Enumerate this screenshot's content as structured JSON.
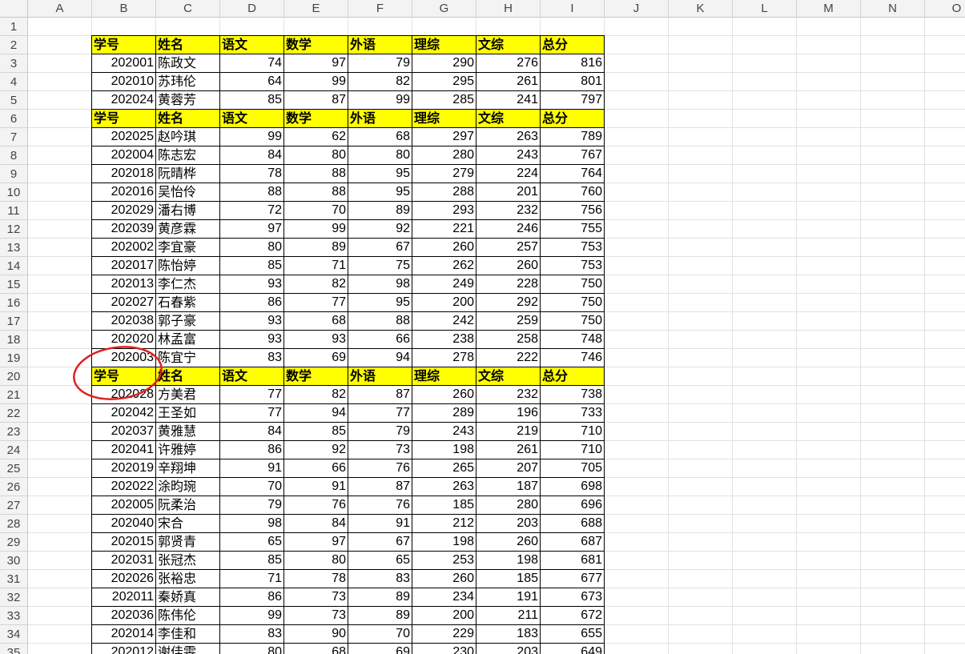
{
  "columns": [
    "A",
    "B",
    "C",
    "D",
    "E",
    "F",
    "G",
    "H",
    "I",
    "J",
    "K",
    "L",
    "M",
    "N",
    "O"
  ],
  "row_numbers": [
    "1",
    "2",
    "3",
    "4",
    "5",
    "6",
    "7",
    "8",
    "9",
    "10",
    "11",
    "12",
    "13",
    "14",
    "15",
    "16",
    "17",
    "18",
    "19",
    "20",
    "21",
    "22",
    "23",
    "24",
    "25",
    "26",
    "27",
    "28",
    "29",
    "30",
    "31",
    "32",
    "33",
    "34",
    "35"
  ],
  "header_labels": [
    "学号",
    "姓名",
    "语文",
    "数学",
    "外语",
    "理综",
    "文综",
    "总分"
  ],
  "header_fill": "#ffff00",
  "annotation_color": "#e02020",
  "rows": [
    null,
    "header",
    [
      "202001",
      "陈政文",
      "74",
      "97",
      "79",
      "290",
      "276",
      "816"
    ],
    [
      "202010",
      "苏玮伦",
      "64",
      "99",
      "82",
      "295",
      "261",
      "801"
    ],
    [
      "202024",
      "黄蓉芳",
      "85",
      "87",
      "99",
      "285",
      "241",
      "797"
    ],
    "header",
    [
      "202025",
      "赵吟琪",
      "99",
      "62",
      "68",
      "297",
      "263",
      "789"
    ],
    [
      "202004",
      "陈志宏",
      "84",
      "80",
      "80",
      "280",
      "243",
      "767"
    ],
    [
      "202018",
      "阮晴桦",
      "78",
      "88",
      "95",
      "279",
      "224",
      "764"
    ],
    [
      "202016",
      "吴怡伶",
      "88",
      "88",
      "95",
      "288",
      "201",
      "760"
    ],
    [
      "202029",
      "潘右博",
      "72",
      "70",
      "89",
      "293",
      "232",
      "756"
    ],
    [
      "202039",
      "黄彦霖",
      "97",
      "99",
      "92",
      "221",
      "246",
      "755"
    ],
    [
      "202002",
      "李宜豪",
      "80",
      "89",
      "67",
      "260",
      "257",
      "753"
    ],
    [
      "202017",
      "陈怡婷",
      "85",
      "71",
      "75",
      "262",
      "260",
      "753"
    ],
    [
      "202013",
      "李仁杰",
      "93",
      "82",
      "98",
      "249",
      "228",
      "750"
    ],
    [
      "202027",
      "石春紫",
      "86",
      "77",
      "95",
      "200",
      "292",
      "750"
    ],
    [
      "202038",
      "郭子豪",
      "93",
      "68",
      "88",
      "242",
      "259",
      "750"
    ],
    [
      "202020",
      "林孟富",
      "93",
      "93",
      "66",
      "238",
      "258",
      "748"
    ],
    [
      "202003",
      "陈宜宁",
      "83",
      "69",
      "94",
      "278",
      "222",
      "746"
    ],
    "header",
    [
      "202028",
      "方美君",
      "77",
      "82",
      "87",
      "260",
      "232",
      "738"
    ],
    [
      "202042",
      "王圣如",
      "77",
      "94",
      "77",
      "289",
      "196",
      "733"
    ],
    [
      "202037",
      "黄雅慧",
      "84",
      "85",
      "79",
      "243",
      "219",
      "710"
    ],
    [
      "202041",
      "许雅婷",
      "86",
      "92",
      "73",
      "198",
      "261",
      "710"
    ],
    [
      "202019",
      "辛翔坤",
      "91",
      "66",
      "76",
      "265",
      "207",
      "705"
    ],
    [
      "202022",
      "涂昀琬",
      "70",
      "91",
      "87",
      "263",
      "187",
      "698"
    ],
    [
      "202005",
      "阮柔治",
      "79",
      "76",
      "76",
      "185",
      "280",
      "696"
    ],
    [
      "202040",
      "宋合",
      "98",
      "84",
      "91",
      "212",
      "203",
      "688"
    ],
    [
      "202015",
      "郭贤青",
      "65",
      "97",
      "67",
      "198",
      "260",
      "687"
    ],
    [
      "202031",
      "张冠杰",
      "85",
      "80",
      "65",
      "253",
      "198",
      "681"
    ],
    [
      "202026",
      "张裕忠",
      "71",
      "78",
      "83",
      "260",
      "185",
      "677"
    ],
    [
      "202011",
      "秦娇真",
      "86",
      "73",
      "89",
      "234",
      "191",
      "673"
    ],
    [
      "202036",
      "陈伟伦",
      "99",
      "73",
      "89",
      "200",
      "211",
      "672"
    ],
    [
      "202014",
      "李佳和",
      "83",
      "90",
      "70",
      "229",
      "183",
      "655"
    ],
    [
      "202012",
      "谢佳雯",
      "80",
      "68",
      "69",
      "230",
      "203",
      "649"
    ]
  ]
}
